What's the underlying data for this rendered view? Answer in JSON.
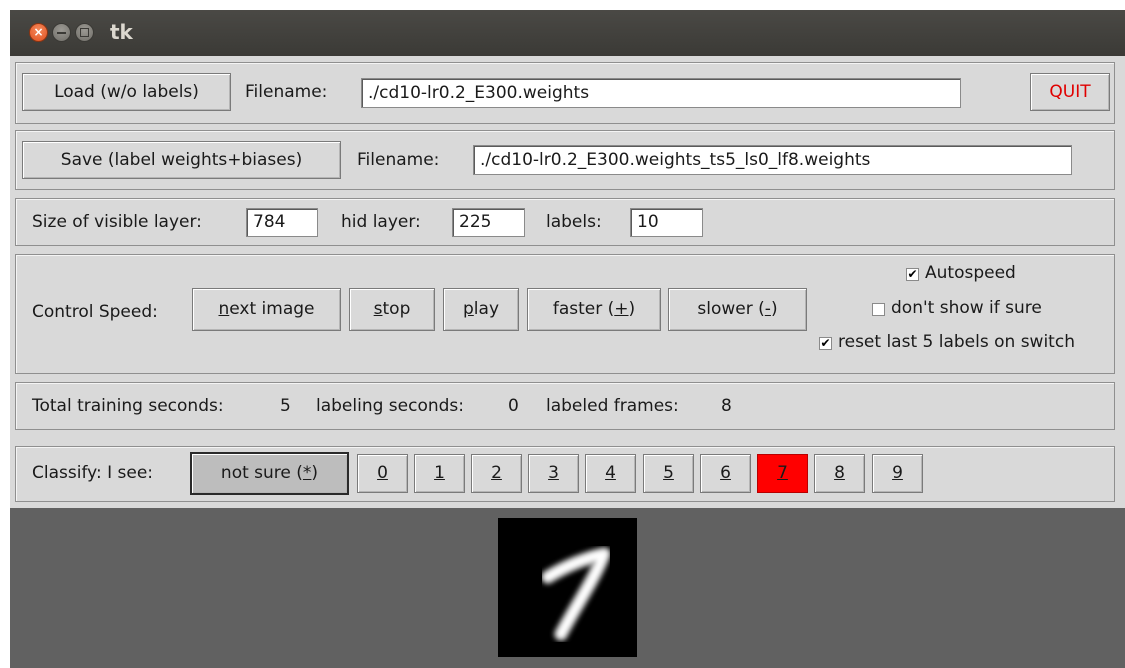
{
  "window": {
    "title": "tk"
  },
  "load_row": {
    "button": "Load (w/o labels)",
    "filename_label": "Filename:",
    "filename_value": "./cd10-lr0.2_E300.weights",
    "quit": "QUIT"
  },
  "save_row": {
    "button": "Save (label weights+biases)",
    "filename_label": "Filename:",
    "filename_value": "./cd10-lr0.2_E300.weights_ts5_ls0_lf8.weights"
  },
  "size_row": {
    "visible_label": "Size of visible layer:",
    "visible_value": "784",
    "hidden_label": "hid layer:",
    "hidden_value": "225",
    "labels_label": "labels:",
    "labels_value": "10"
  },
  "speed_row": {
    "label": "Control Speed:",
    "buttons": [
      {
        "pre": "",
        "key": "n",
        "post": "ext image"
      },
      {
        "pre": "",
        "key": "s",
        "post": "top"
      },
      {
        "pre": "",
        "key": "p",
        "post": "lay"
      },
      {
        "pre": "faster (",
        "key": "+",
        "post": ")"
      },
      {
        "pre": "slower (",
        "key": "-",
        "post": ")"
      }
    ],
    "checkboxes": [
      {
        "label": "Autospeed",
        "checked": true
      },
      {
        "label": "don't show if sure",
        "checked": false
      },
      {
        "label": "reset last 5 labels on switch",
        "checked": true
      }
    ]
  },
  "stats_row": {
    "training_label": "Total training seconds:",
    "training_value": "5",
    "labeling_label": "labeling seconds:",
    "labeling_value": "0",
    "frames_label": "labeled frames:",
    "frames_value": "8"
  },
  "classify_row": {
    "label": "Classify: I see:",
    "not_sure": {
      "pre": "not sure (",
      "key": "*",
      "post": ")"
    },
    "digits": [
      "0",
      "1",
      "2",
      "3",
      "4",
      "5",
      "6",
      "7",
      "8",
      "9"
    ],
    "selected_digit": "7",
    "selected_color": "#ff0000"
  },
  "canvas": {
    "image": "handwritten-digit-seven"
  }
}
